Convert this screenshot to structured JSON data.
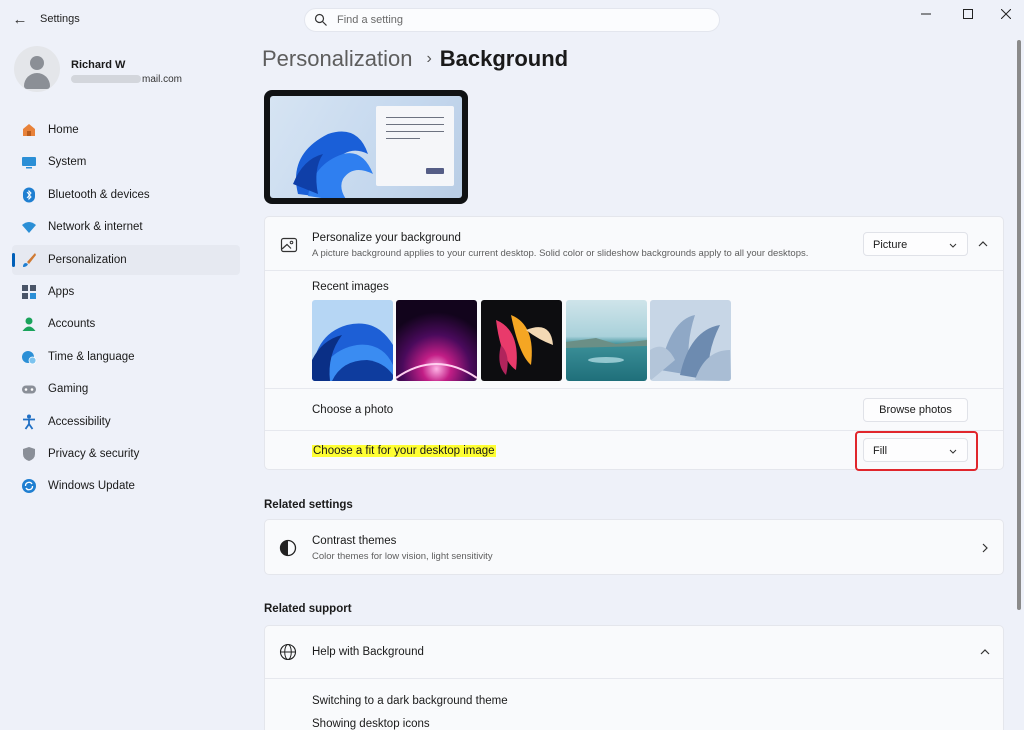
{
  "app": {
    "title": "Settings",
    "back_icon": "back-arrow-icon"
  },
  "search": {
    "placeholder": "Find a setting",
    "value": ""
  },
  "window_controls": [
    "minimize-icon",
    "maximize-icon",
    "close-icon"
  ],
  "profile": {
    "name": "Richard W",
    "email_visible_suffix": "mail.com"
  },
  "sidebar": {
    "items": [
      {
        "label": "Home",
        "icon": "home-icon",
        "active": false
      },
      {
        "label": "System",
        "icon": "system-icon",
        "active": false
      },
      {
        "label": "Bluetooth & devices",
        "icon": "bluetooth-icon",
        "active": false
      },
      {
        "label": "Network & internet",
        "icon": "network-icon",
        "active": false
      },
      {
        "label": "Personalization",
        "icon": "brush-icon",
        "active": true
      },
      {
        "label": "Apps",
        "icon": "apps-icon",
        "active": false
      },
      {
        "label": "Accounts",
        "icon": "accounts-icon",
        "active": false
      },
      {
        "label": "Time & language",
        "icon": "globe-clock-icon",
        "active": false
      },
      {
        "label": "Gaming",
        "icon": "gamepad-icon",
        "active": false
      },
      {
        "label": "Accessibility",
        "icon": "accessibility-icon",
        "active": false
      },
      {
        "label": "Privacy & security",
        "icon": "shield-icon",
        "active": false
      },
      {
        "label": "Windows Update",
        "icon": "update-icon",
        "active": false
      }
    ]
  },
  "breadcrumb": {
    "parent": "Personalization",
    "separator": "›",
    "current": "Background"
  },
  "background_card": {
    "title": "Personalize your background",
    "subtitle": "A picture background applies to your current desktop. Solid color or slideshow backgrounds apply to all your desktops.",
    "type_dropdown": "Picture",
    "recent_images_label": "Recent images",
    "choose_photo_label": "Choose a photo",
    "browse_button": "Browse photos",
    "fit_label": "Choose a fit for your desktop image",
    "fit_dropdown": "Fill"
  },
  "related_settings": {
    "header": "Related settings",
    "contrast_title": "Contrast themes",
    "contrast_subtitle": "Color themes for low vision, light sensitivity"
  },
  "related_support": {
    "header": "Related support",
    "help_title": "Help with Background",
    "links": [
      "Switching to a dark background theme",
      "Showing desktop icons"
    ]
  },
  "colors": {
    "accent": "#005fb8",
    "highlight": "#ffff33",
    "annotation_red": "#e0262c"
  }
}
